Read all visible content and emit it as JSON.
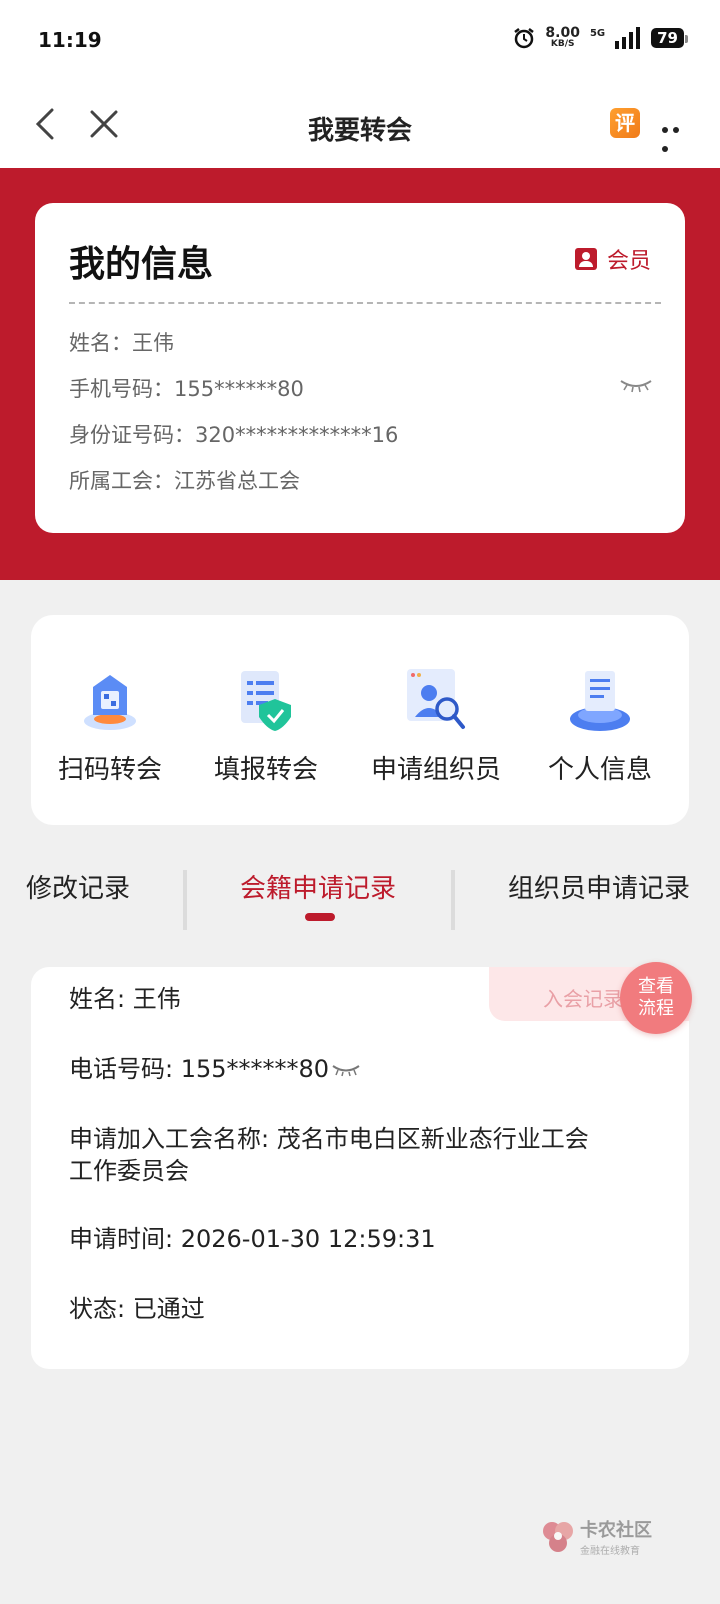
{
  "status_bar": {
    "time": "11:19",
    "speed_value": "8.00",
    "speed_unit": "KB/S",
    "network": "5G",
    "battery": "79"
  },
  "nav": {
    "title": "我要转会",
    "rate_icon_label": "评"
  },
  "info_card": {
    "title": "我的信息",
    "badge": "会员",
    "name": "姓名：王伟",
    "phone": "手机号码：155******80",
    "id_number": "身份证号码：320*************16",
    "union": "所属工会：江苏省总工会"
  },
  "actions": [
    {
      "label": "扫码转会",
      "icon": "scan-transfer-icon"
    },
    {
      "label": "填报转会",
      "icon": "form-transfer-icon"
    },
    {
      "label": "申请组织员",
      "icon": "apply-organizer-icon"
    },
    {
      "label": "个人信息",
      "icon": "personal-info-icon"
    }
  ],
  "tabs": [
    {
      "label": "修改记录",
      "active": false
    },
    {
      "label": "会籍申请记录",
      "active": true
    },
    {
      "label": "组织员申请记录",
      "active": false
    }
  ],
  "record": {
    "tag": "入会记录",
    "name": "姓名: 王伟",
    "phone": "电话号码: 155******80",
    "union_line1": "申请加入工会名称: 茂名市电白区新业态行业工会",
    "union_line2": "工作委员会",
    "time": "申请时间: 2026-01-30 12:59:31",
    "status": "状态: 已通过",
    "flow_button_line1": "查看",
    "flow_button_line2": "流程"
  },
  "watermark": {
    "title": "卡农社区",
    "subtitle": "金融在线教育"
  },
  "colors": {
    "brand_red": "#bd1b2c",
    "background": "#f0f0f0",
    "flow_button": "#f17b7e"
  }
}
